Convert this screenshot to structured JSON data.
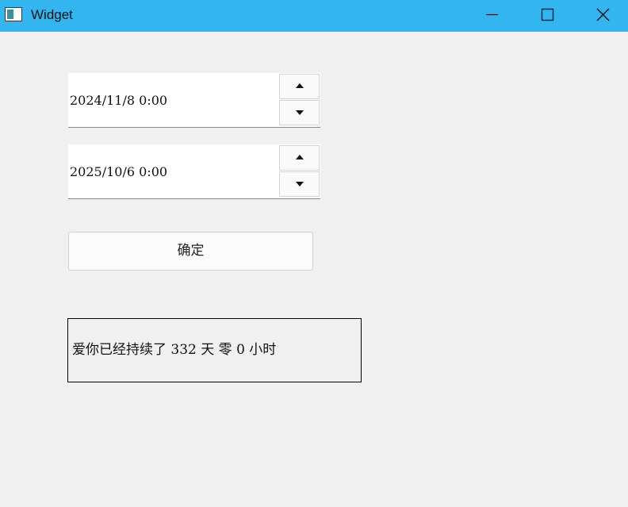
{
  "window": {
    "title": "Widget",
    "icon": "app-window-icon",
    "controls": [
      "minimize-icon",
      "maximize-icon",
      "close-icon"
    ],
    "titlebar_color": "#33b5f0"
  },
  "start_datetime": {
    "value": "2024/11/8 0:00"
  },
  "end_datetime": {
    "value": "2025/10/6 0:00"
  },
  "confirm_button": {
    "label": "确定"
  },
  "result": {
    "text": "爱你已经持续了 332 天 零 0 小时"
  }
}
